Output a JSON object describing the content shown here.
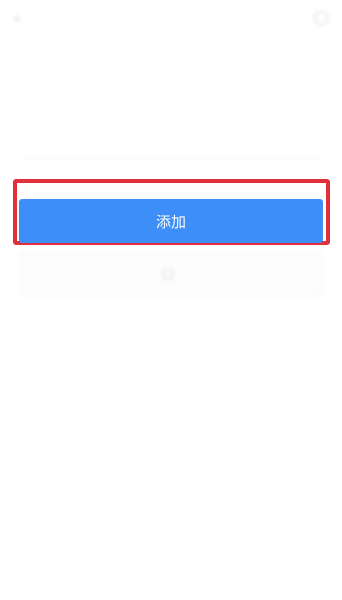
{
  "header": {
    "title": "",
    "back_icon": "chevron-left-icon",
    "right_icon": "search-icon"
  },
  "info": {
    "line1": "",
    "line2": ""
  },
  "form": {
    "field_label": ""
  },
  "actions": {
    "add_label": "添加",
    "secondary_label": "",
    "secondary_icon": "scan-icon"
  },
  "footer": {
    "text": ""
  },
  "colors": {
    "primary": "#3d8ef7",
    "highlight": "#e0303c"
  }
}
